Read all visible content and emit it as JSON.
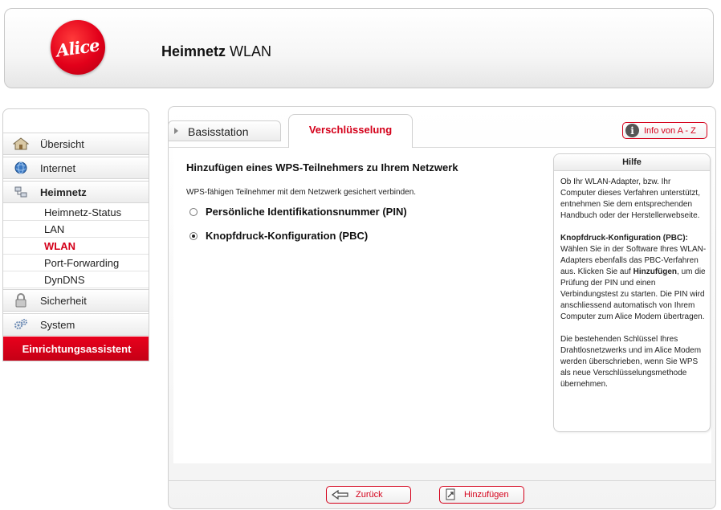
{
  "header": {
    "logo_text": "Alice",
    "title_bold": "Heimnetz",
    "title_rest": "WLAN"
  },
  "sidebar": {
    "items": [
      {
        "label": "Übersicht",
        "icon": "house-icon"
      },
      {
        "label": "Internet",
        "icon": "globe-icon"
      },
      {
        "label": "Heimnetz",
        "icon": "network-icon"
      }
    ],
    "subitems": [
      {
        "label": "Heimnetz-Status"
      },
      {
        "label": "LAN"
      },
      {
        "label": "WLAN",
        "active": true
      },
      {
        "label": "Port-Forwarding"
      },
      {
        "label": "DynDNS"
      }
    ],
    "items2": [
      {
        "label": "Sicherheit",
        "icon": "lock-icon"
      },
      {
        "label": "System",
        "icon": "gears-icon"
      }
    ],
    "wizard_label": "Einrichtungsassistent"
  },
  "tabs": {
    "basisstation": "Basisstation",
    "verschluesselung": "Verschlüsselung"
  },
  "info_button": {
    "label": "Info von A - Z"
  },
  "main": {
    "section_title": "Hinzufügen eines WPS-Teilnehmers zu Ihrem Netzwerk",
    "intro": "WPS-fähigen Teilnehmer mit dem Netzwerk gesichert verbinden.",
    "options": [
      {
        "label": "Persönliche Identifikationsnummer (PIN)",
        "selected": false
      },
      {
        "label": "Knopfdruck-Konfiguration (PBC)",
        "selected": true
      }
    ]
  },
  "help": {
    "title": "Hilfe",
    "p1": "Ob Ihr WLAN-Adapter, bzw. Ihr Computer dieses Verfahren unterstützt, entnehmen Sie dem entsprechenden Handbuch oder der Herstellerwebseite.",
    "p2_title": "Knopfdruck-Konfiguration (PBC):",
    "p2_a": "Wählen Sie in der Software Ihres WLAN-Adapters ebenfalls das PBC-Verfahren aus. Klicken Sie auf",
    "p2_bold": "Hinzufügen",
    "p2_b": ", um die Prüfung der PIN und einen Verbindungstest zu starten. Die PIN wird anschliessend automatisch von Ihrem Computer zum Alice Modem übertragen.",
    "p3": "Die bestehenden Schlüssel Ihres Drahtlosnetzwerks und im Alice Modem werden überschrieben, wenn Sie WPS als neue Verschlüsselungsmethode übernehmen."
  },
  "buttons": {
    "back": "Zurück",
    "add": "Hinzufügen"
  },
  "colors": {
    "accent": "#d4001a"
  }
}
